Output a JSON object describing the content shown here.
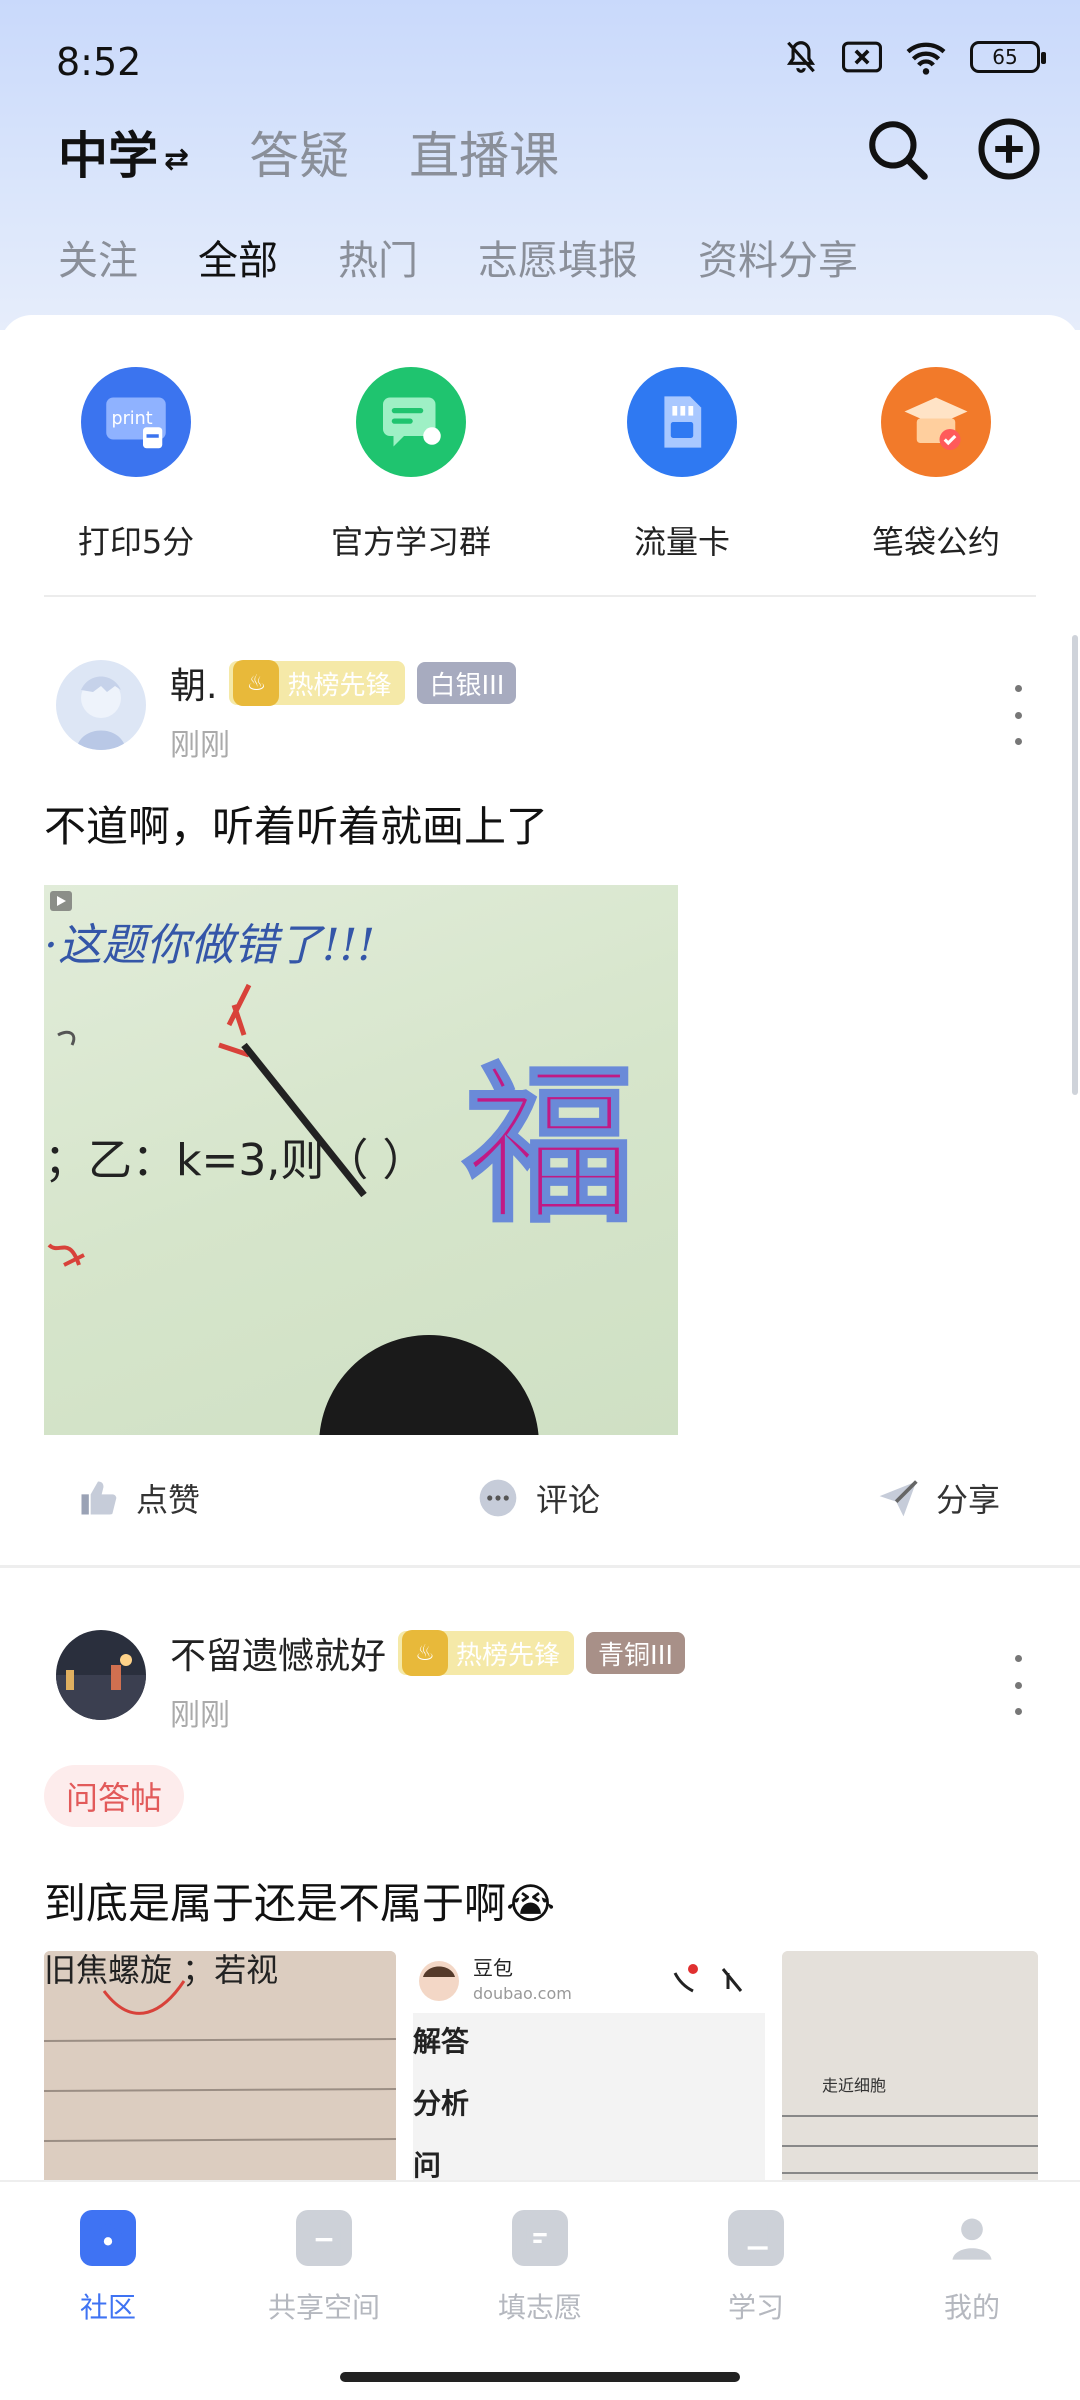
{
  "status_bar": {
    "time": "8:52",
    "battery": "65"
  },
  "header": {
    "main_tabs": [
      {
        "label": "中学",
        "active": true
      },
      {
        "label": "答疑",
        "active": false
      },
      {
        "label": "直播课",
        "active": false
      }
    ],
    "switch_glyph": "⇄",
    "sub_tabs": [
      {
        "label": "关注",
        "active": false
      },
      {
        "label": "全部",
        "active": true
      },
      {
        "label": "热门",
        "active": false
      },
      {
        "label": "志愿填报",
        "active": false
      },
      {
        "label": "资料分享",
        "active": false
      }
    ]
  },
  "quick_links": [
    {
      "label": "打印5分",
      "icon": "print-icon",
      "icon_text": "print",
      "color": "#3b74ef"
    },
    {
      "label": "官方学习群",
      "icon": "chat-group-icon",
      "color": "#1fc46f"
    },
    {
      "label": "流量卡",
      "icon": "sim-card-icon",
      "color": "#2f79f2"
    },
    {
      "label": "笔袋公约",
      "icon": "graduation-cap-icon",
      "color": "#f27a2a"
    }
  ],
  "posts": [
    {
      "author": "朝.",
      "hot_badge": "热榜先锋",
      "rank_badge": "白银III",
      "time": "刚刚",
      "text": "不道啊，听着听着就画上了",
      "image": {
        "handwriting": "·这题你做错了!!!",
        "equation": "；乙：k=3,则（   ）",
        "character": "福"
      }
    },
    {
      "author": "不留遗憾就好",
      "hot_badge": "热榜先锋",
      "rank_badge": "青铜III",
      "time": "刚刚",
      "tag": "问答帖",
      "text": "到底是属于还是不属于啊😭",
      "thumbs": [
        {
          "text": "旧焦螺旋 ；若视"
        },
        {
          "app_name": "豆包",
          "app_url": "doubao.com",
          "lines": [
            "解答",
            "分析",
            "问"
          ]
        },
        {
          "text": "走近细胞"
        }
      ]
    }
  ],
  "post_actions": {
    "like": "点赞",
    "comment": "评论",
    "share": "分享"
  },
  "bottom_nav": [
    {
      "label": "社区",
      "icon": "home-icon",
      "active": true
    },
    {
      "label": "共享空间",
      "icon": "folder-icon",
      "active": false
    },
    {
      "label": "填志愿",
      "icon": "form-icon",
      "active": false
    },
    {
      "label": "学习",
      "icon": "book-icon",
      "active": false
    },
    {
      "label": "我的",
      "icon": "profile-icon",
      "active": false
    }
  ],
  "colors": {
    "accent": "#3f73f3",
    "header_bg": "#c9d9fb",
    "qa_tag": "#e25a5a"
  }
}
